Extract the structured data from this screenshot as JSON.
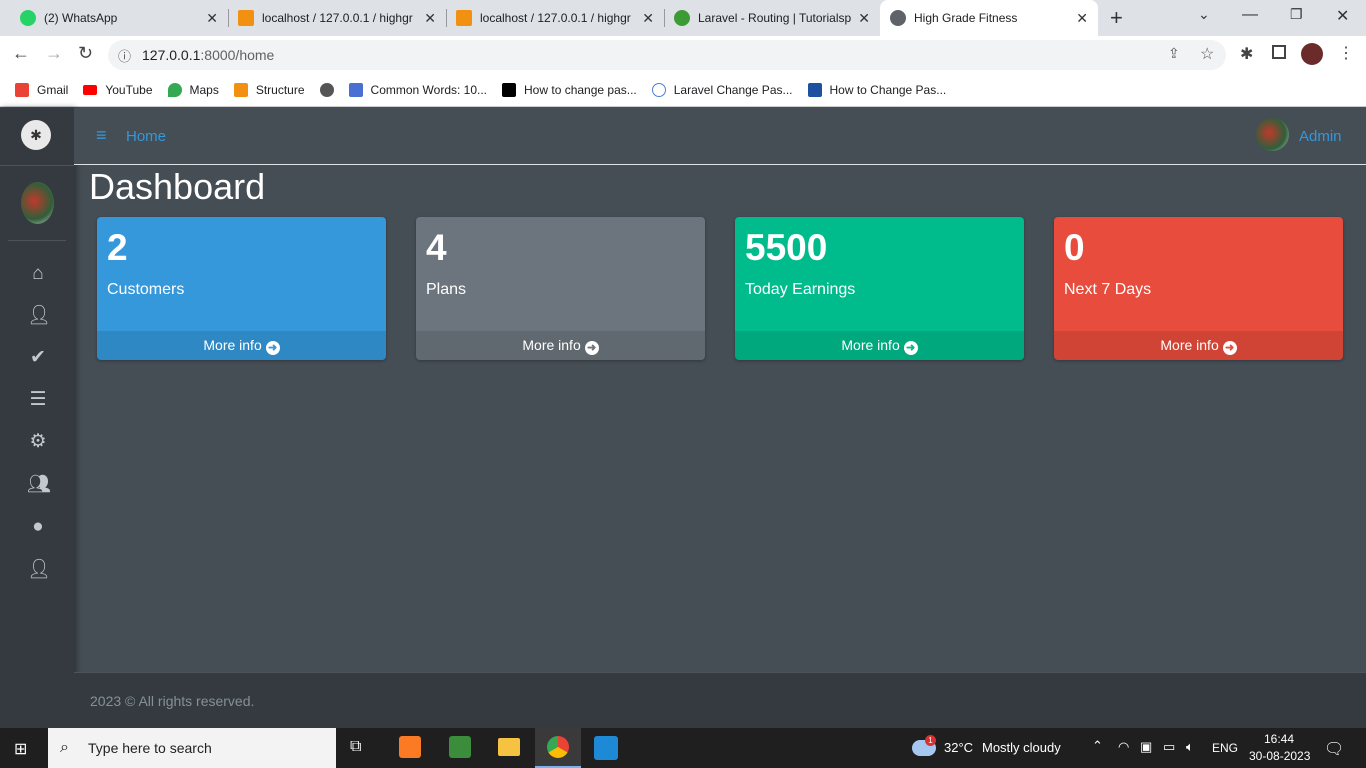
{
  "browser": {
    "tabs": [
      {
        "title": "(2) WhatsApp",
        "color": "#25d366"
      },
      {
        "title": "localhost / 127.0.0.1 / highgr",
        "color": "#f29111"
      },
      {
        "title": "localhost / 127.0.0.1 / highgr",
        "color": "#f29111"
      },
      {
        "title": "Laravel - Routing | Tutorialsp",
        "color": "#3d9b35"
      },
      {
        "title": "High Grade Fitness",
        "color": "#5f6368"
      }
    ],
    "url_host": "127.0.0.1",
    "url_rest": ":8000/home",
    "bookmarks": [
      "Gmail",
      "YouTube",
      "Maps",
      "Structure",
      "",
      "Common Words: 10...",
      "How to change pas...",
      "Laravel Change Pas...",
      "How to Change Pas..."
    ]
  },
  "navbar": {
    "home": "Home",
    "user": "Admin"
  },
  "page": {
    "title": "Dashboard"
  },
  "cards": [
    {
      "value": "2",
      "label": "Customers",
      "more": "More info",
      "color": "#3498db"
    },
    {
      "value": "4",
      "label": "Plans",
      "more": "More info",
      "color": "#6c757d"
    },
    {
      "value": "5500",
      "label": "Today Earnings",
      "more": "More info",
      "color": "#00bc8c"
    },
    {
      "value": "0",
      "label": "Next 7 Days",
      "more": "More info",
      "color": "#e74c3c"
    }
  ],
  "footer": {
    "text": "2023 © All rights reserved."
  },
  "taskbar": {
    "search": "Type here to search",
    "weather": "32°C",
    "weather_desc": "Mostly cloudy",
    "weather_badge": "1",
    "lang": "ENG",
    "time": "16:44",
    "date": "30-08-2023"
  }
}
